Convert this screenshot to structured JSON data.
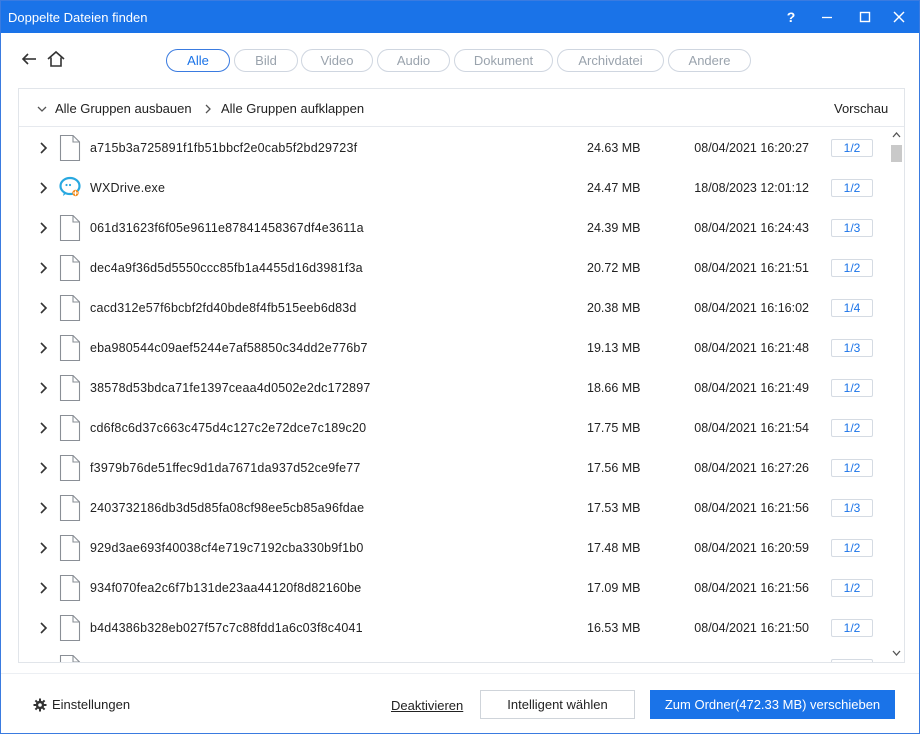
{
  "window": {
    "title": "Doppelte Dateien finden",
    "help_label": "?"
  },
  "filters": [
    {
      "label": "Alle",
      "active": true
    },
    {
      "label": "Bild",
      "active": false
    },
    {
      "label": "Video",
      "active": false
    },
    {
      "label": "Audio",
      "active": false
    },
    {
      "label": "Dokument",
      "active": false
    },
    {
      "label": "Archivdatei",
      "active": false
    },
    {
      "label": "Andere",
      "active": false
    }
  ],
  "list_header": {
    "expand_all": "Alle Gruppen ausbauen",
    "collapse_all": "Alle Gruppen aufklappen",
    "preview": "Vorschau"
  },
  "rows": [
    {
      "name": "a715b3a725891f1fb51bbcf2e0cab5f2bd29723f",
      "size": "24.63 MB",
      "date": "08/04/2021 16:20:27",
      "preview": "1/2",
      "icon": "file-icon"
    },
    {
      "name": "WXDrive.exe",
      "size": "24.47 MB",
      "date": "18/08/2023 12:01:12",
      "preview": "1/2",
      "icon": "wxdrive-app-icon"
    },
    {
      "name": "061d31623f6f05e9611e87841458367df4e3611a",
      "size": "24.39 MB",
      "date": "08/04/2021 16:24:43",
      "preview": "1/3",
      "icon": "file-icon"
    },
    {
      "name": "dec4a9f36d5d5550ccc85fb1a4455d16d3981f3a",
      "size": "20.72 MB",
      "date": "08/04/2021 16:21:51",
      "preview": "1/2",
      "icon": "file-icon"
    },
    {
      "name": "cacd312e57f6bcbf2fd40bde8f4fb515eeb6d83d",
      "size": "20.38 MB",
      "date": "08/04/2021 16:16:02",
      "preview": "1/4",
      "icon": "file-icon"
    },
    {
      "name": "eba980544c09aef5244e7af58850c34dd2e776b7",
      "size": "19.13 MB",
      "date": "08/04/2021 16:21:48",
      "preview": "1/3",
      "icon": "file-icon"
    },
    {
      "name": "38578d53bdca71fe1397ceaa4d0502e2dc172897",
      "size": "18.66 MB",
      "date": "08/04/2021 16:21:49",
      "preview": "1/2",
      "icon": "file-icon"
    },
    {
      "name": "cd6f8c6d37c663c475d4c127c2e72dce7c189c20",
      "size": "17.75 MB",
      "date": "08/04/2021 16:21:54",
      "preview": "1/2",
      "icon": "file-icon"
    },
    {
      "name": "f3979b76de51ffec9d1da7671da937d52ce9fe77",
      "size": "17.56 MB",
      "date": "08/04/2021 16:27:26",
      "preview": "1/2",
      "icon": "file-icon"
    },
    {
      "name": "2403732186db3d5d85fa08cf98ee5cb85a96fdae",
      "size": "17.53 MB",
      "date": "08/04/2021 16:21:56",
      "preview": "1/3",
      "icon": "file-icon"
    },
    {
      "name": "929d3ae693f40038cf4e719c7192cba330b9f1b0",
      "size": "17.48 MB",
      "date": "08/04/2021 16:20:59",
      "preview": "1/2",
      "icon": "file-icon"
    },
    {
      "name": "934f070fea2c6f7b131de23aa44120f8d82160be",
      "size": "17.09 MB",
      "date": "08/04/2021 16:21:56",
      "preview": "1/2",
      "icon": "file-icon"
    },
    {
      "name": "b4d4386b328eb027f57c7c88fdd1a6c03f8c4041",
      "size": "16.53 MB",
      "date": "08/04/2021 16:21:50",
      "preview": "1/2",
      "icon": "file-icon"
    }
  ],
  "footer": {
    "settings_label": "Einstellungen",
    "deactivate_label": "Deaktivieren",
    "smart_select_label": "Intelligent wählen",
    "move_label": "Zum Ordner(472.33 MB) verschieben"
  },
  "colors": {
    "accent": "#1a73e8",
    "border": "#e1e5ea"
  }
}
